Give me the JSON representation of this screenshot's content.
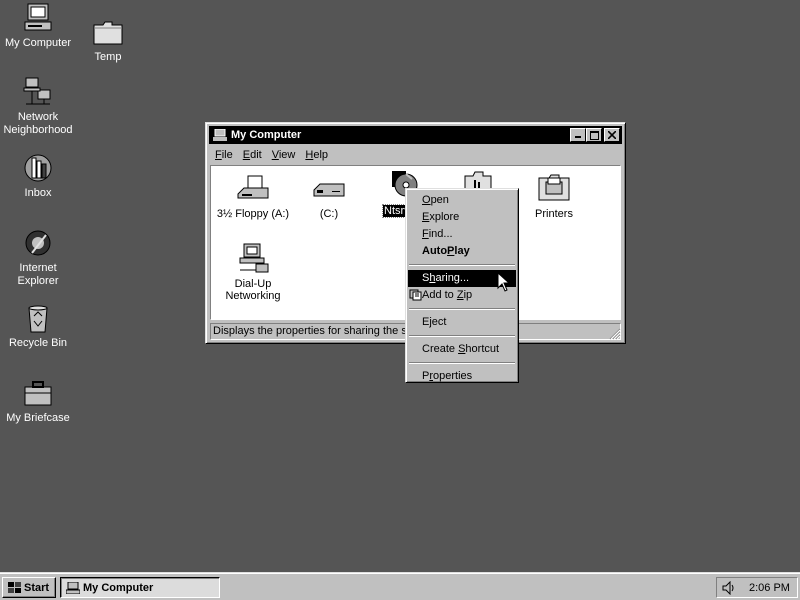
{
  "desktop": {
    "icons": [
      {
        "label": "My Computer"
      },
      {
        "label": "Temp"
      },
      {
        "label_line1": "Network",
        "label_line2": "Neighborhood"
      },
      {
        "label": "Inbox"
      },
      {
        "label_line1": "Internet",
        "label_line2": "Explorer"
      },
      {
        "label": "Recycle Bin"
      },
      {
        "label": "My Briefcase"
      }
    ]
  },
  "window": {
    "title": "My Computer",
    "menu": [
      {
        "ul": "F",
        "rest": "ile"
      },
      {
        "ul": "E",
        "rest": "dit"
      },
      {
        "ul": "V",
        "rest": "iew"
      },
      {
        "ul": "H",
        "rest": "elp"
      }
    ],
    "items": [
      {
        "label": "3½ Floppy (A:)"
      },
      {
        "label": "(C:)"
      },
      {
        "label": "Ntsrv40"
      },
      {
        "label": "Printers"
      },
      {
        "label_line1": "Dial-Up",
        "label_line2": "Networking"
      }
    ],
    "status": "Displays the properties for sharing the sel"
  },
  "context_menu": {
    "items": [
      {
        "ul": "O",
        "rest": "pen"
      },
      {
        "ul": "E",
        "rest": "xplore"
      },
      {
        "ul": "F",
        "rest": "ind..."
      },
      {
        "pre": "Auto",
        "ul": "P",
        "rest": "lay"
      },
      {
        "pre": "S",
        "ul": "h",
        "rest": "aring..."
      },
      {
        "pre": "Add to ",
        "ul": "Z",
        "rest": "ip"
      },
      {
        "label": "Eject"
      },
      {
        "pre": "Create ",
        "ul": "S",
        "rest": "hortcut"
      },
      {
        "pre": "P",
        "ul": "r",
        "rest": "operties"
      }
    ]
  },
  "taskbar": {
    "start_label": "Start",
    "task_label": "My Computer",
    "clock": "2:06 PM"
  }
}
